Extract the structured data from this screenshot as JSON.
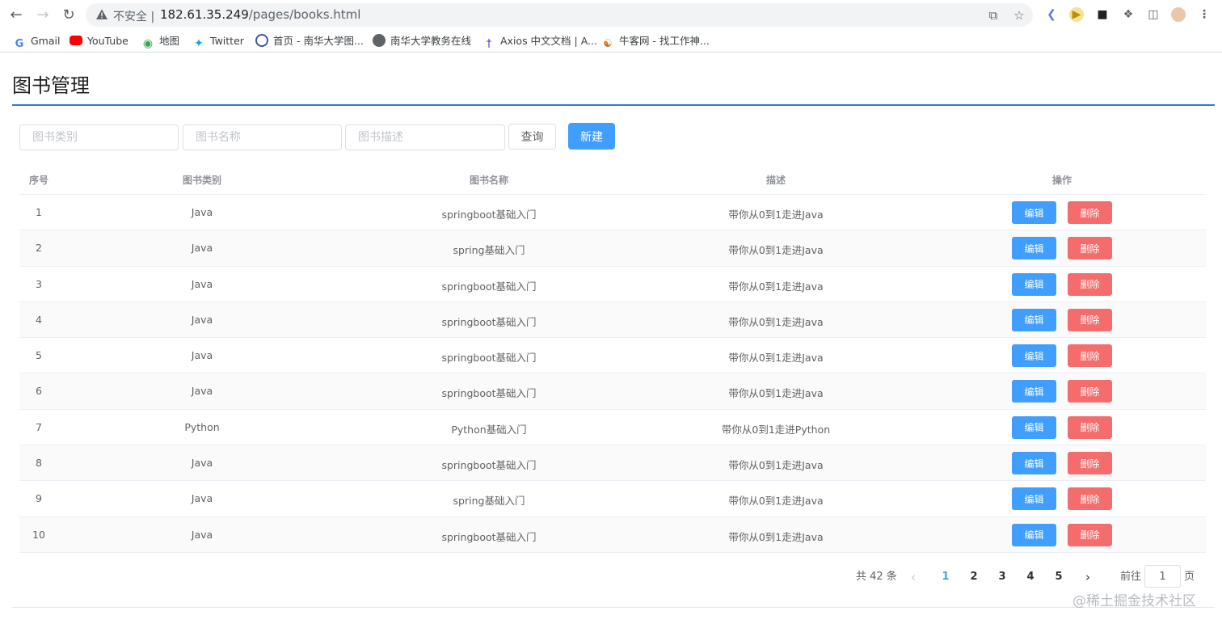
{
  "browser": {
    "security_label": "不安全",
    "url_host": "182.61.35.249",
    "url_path": "/pages/books.html",
    "bookmarks": [
      {
        "label": "Gmail",
        "icon": "gmail-icon"
      },
      {
        "label": "YouTube",
        "icon": "youtube-icon"
      },
      {
        "label": "地图",
        "icon": "maps-icon"
      },
      {
        "label": "Twitter",
        "icon": "twitter-icon"
      },
      {
        "label": "首页 - 南华大学图...",
        "icon": "library-icon"
      },
      {
        "label": "南华大学教务在线",
        "icon": "globe-icon"
      },
      {
        "label": "Axios 中文文档 | A...",
        "icon": "axios-icon"
      },
      {
        "label": "牛客网 - 找工作神...",
        "icon": "nowcoder-icon"
      }
    ]
  },
  "page": {
    "title": "图书管理"
  },
  "filters": {
    "type_placeholder": "图书类别",
    "name_placeholder": "图书名称",
    "desc_placeholder": "图书描述",
    "query_label": "查询",
    "new_label": "新建"
  },
  "table": {
    "headers": [
      "序号",
      "图书类别",
      "图书名称",
      "描述",
      "操作"
    ],
    "edit_label": "编辑",
    "delete_label": "删除",
    "rows": [
      {
        "no": "1",
        "type": "Java",
        "name": "springboot基础入门",
        "desc": "带你从0到1走进Java"
      },
      {
        "no": "2",
        "type": "Java",
        "name": "spring基础入门",
        "desc": "带你从0到1走进Java"
      },
      {
        "no": "3",
        "type": "Java",
        "name": "springboot基础入门",
        "desc": "带你从0到1走进Java"
      },
      {
        "no": "4",
        "type": "Java",
        "name": "springboot基础入门",
        "desc": "带你从0到1走进Java"
      },
      {
        "no": "5",
        "type": "Java",
        "name": "springboot基础入门",
        "desc": "带你从0到1走进Java"
      },
      {
        "no": "6",
        "type": "Java",
        "name": "springboot基础入门",
        "desc": "带你从0到1走进Java"
      },
      {
        "no": "7",
        "type": "Python",
        "name": "Python基础入门",
        "desc": "带你从0到1走进Python"
      },
      {
        "no": "8",
        "type": "Java",
        "name": "springboot基础入门",
        "desc": "带你从0到1走进Java"
      },
      {
        "no": "9",
        "type": "Java",
        "name": "spring基础入门",
        "desc": "带你从0到1走进Java"
      },
      {
        "no": "10",
        "type": "Java",
        "name": "springboot基础入门",
        "desc": "带你从0到1走进Java"
      }
    ]
  },
  "pagination": {
    "total_label": "共 42 条",
    "pages": [
      "1",
      "2",
      "3",
      "4",
      "5"
    ],
    "current_page": "1",
    "goto_label": "前往",
    "goto_value": "1",
    "page_suffix": "页"
  },
  "watermark": "@稀土掘金技术社区",
  "colors": {
    "primary": "#409eff",
    "danger": "#f56c6c",
    "title_rule": "#2d7ec5"
  }
}
